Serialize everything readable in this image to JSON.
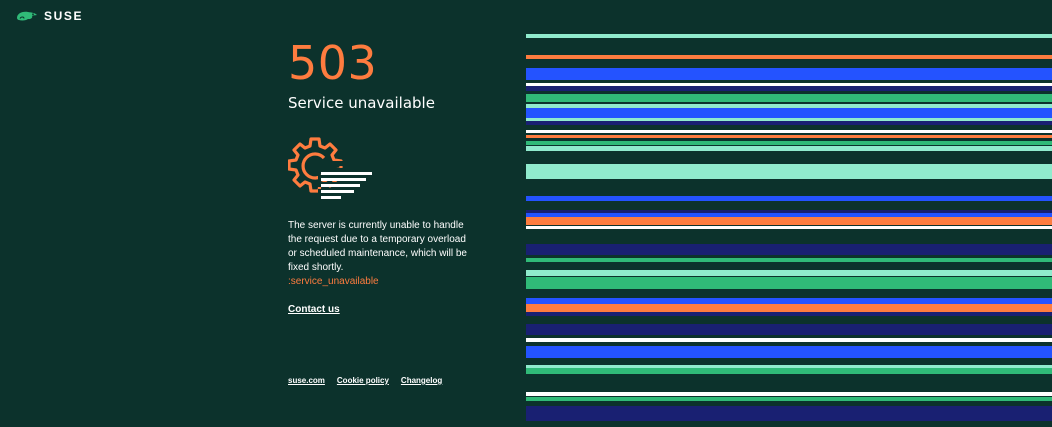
{
  "brand": {
    "name": "SUSE",
    "logo_icon": "chameleon-logo-icon"
  },
  "error": {
    "code": "503",
    "title": "Service unavailable",
    "illustration_icon": "gear-maintenance-icon",
    "description": "The server is currently unable to handle the request due to a temporary overload or scheduled maintenance, which will be fixed shortly.",
    "error_id": ":service_unavailable"
  },
  "contact_label": "Contact us",
  "footer": {
    "links": [
      "suse.com",
      "Cookie policy",
      "Changelog"
    ]
  },
  "colors": {
    "background": "#0c322c",
    "accent": "#fe7c3f",
    "stripe_mint": "#90ebcd",
    "stripe_green": "#30ba78",
    "stripe_blue": "#2453ff",
    "stripe_navy": "#192072",
    "stripe_orange": "#fe7c3f",
    "stripe_white": "#ffffff"
  }
}
